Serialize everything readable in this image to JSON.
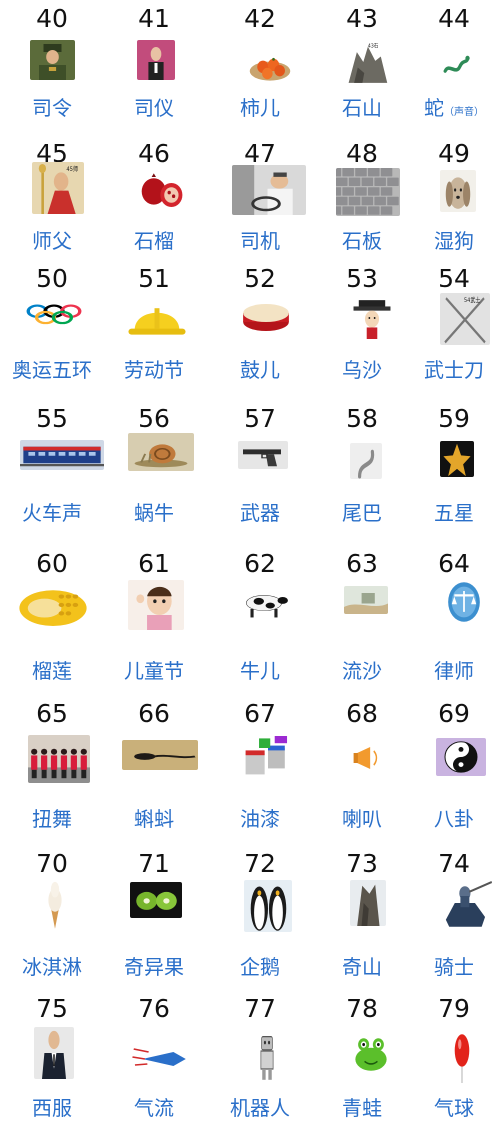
{
  "colors": {
    "number": "#111111",
    "word": "#2a6fc9",
    "background": "#ffffff"
  },
  "items": [
    {
      "num": "40",
      "word": "司令",
      "icon": "soldier-icon"
    },
    {
      "num": "41",
      "word": "司仪",
      "icon": "host-icon"
    },
    {
      "num": "42",
      "word": "柿儿",
      "icon": "persimmon-icon"
    },
    {
      "num": "43",
      "word": "石山",
      "icon": "rock-icon",
      "pic_text": "43石"
    },
    {
      "num": "44",
      "word": "蛇",
      "sub": "（声音）",
      "icon": "snake-icon"
    },
    {
      "num": "45",
      "word": "师父",
      "icon": "monk-icon",
      "pic_text": "45师"
    },
    {
      "num": "46",
      "word": "石榴",
      "icon": "pomegranate-icon"
    },
    {
      "num": "47",
      "word": "司机",
      "icon": "driver-icon"
    },
    {
      "num": "48",
      "word": "石板",
      "icon": "stone-slab-icon"
    },
    {
      "num": "49",
      "word": "湿狗",
      "icon": "dog-icon"
    },
    {
      "num": "50",
      "word": "奥运五环",
      "icon": "olympic-rings-icon"
    },
    {
      "num": "51",
      "word": "劳动节",
      "icon": "hard-hat-icon"
    },
    {
      "num": "52",
      "word": "鼓儿",
      "icon": "drum-icon"
    },
    {
      "num": "53",
      "word": "乌沙",
      "icon": "hat-doll-icon"
    },
    {
      "num": "54",
      "word": "武士刀",
      "icon": "katana-icon",
      "pic_text": "54武士"
    },
    {
      "num": "55",
      "word": "火车声",
      "icon": "train-icon"
    },
    {
      "num": "56",
      "word": "蜗牛",
      "icon": "snail-icon"
    },
    {
      "num": "57",
      "word": "武器",
      "icon": "pistol-icon"
    },
    {
      "num": "58",
      "word": "尾巴",
      "icon": "tail-icon"
    },
    {
      "num": "59",
      "word": "五星",
      "icon": "star-icon"
    },
    {
      "num": "60",
      "word": "榴莲",
      "icon": "durian-icon"
    },
    {
      "num": "61",
      "word": "儿童节",
      "icon": "child-icon"
    },
    {
      "num": "62",
      "word": "牛儿",
      "icon": "cow-icon"
    },
    {
      "num": "63",
      "word": "流沙",
      "icon": "quicksand-icon"
    },
    {
      "num": "64",
      "word": "律师",
      "icon": "scales-icon"
    },
    {
      "num": "65",
      "word": "扭舞",
      "icon": "dancers-icon"
    },
    {
      "num": "66",
      "word": "蝌蚪",
      "icon": "tadpole-icon"
    },
    {
      "num": "67",
      "word": "油漆",
      "icon": "paint-icon"
    },
    {
      "num": "68",
      "word": "喇叭",
      "icon": "horn-icon"
    },
    {
      "num": "69",
      "word": "八卦",
      "icon": "yin-yang-icon"
    },
    {
      "num": "70",
      "word": "冰淇淋",
      "icon": "ice-cream-icon"
    },
    {
      "num": "71",
      "word": "奇异果",
      "icon": "kiwi-icon"
    },
    {
      "num": "72",
      "word": "企鹅",
      "icon": "penguin-icon"
    },
    {
      "num": "73",
      "word": "奇山",
      "icon": "mountain-icon"
    },
    {
      "num": "74",
      "word": "骑士",
      "icon": "knight-icon"
    },
    {
      "num": "75",
      "word": "西服",
      "icon": "suit-icon"
    },
    {
      "num": "76",
      "word": "气流",
      "icon": "airflow-icon"
    },
    {
      "num": "77",
      "word": "机器人",
      "icon": "robot-icon"
    },
    {
      "num": "78",
      "word": "青蛙",
      "icon": "frog-icon"
    },
    {
      "num": "79",
      "word": "气球",
      "icon": "balloon-icon"
    }
  ]
}
